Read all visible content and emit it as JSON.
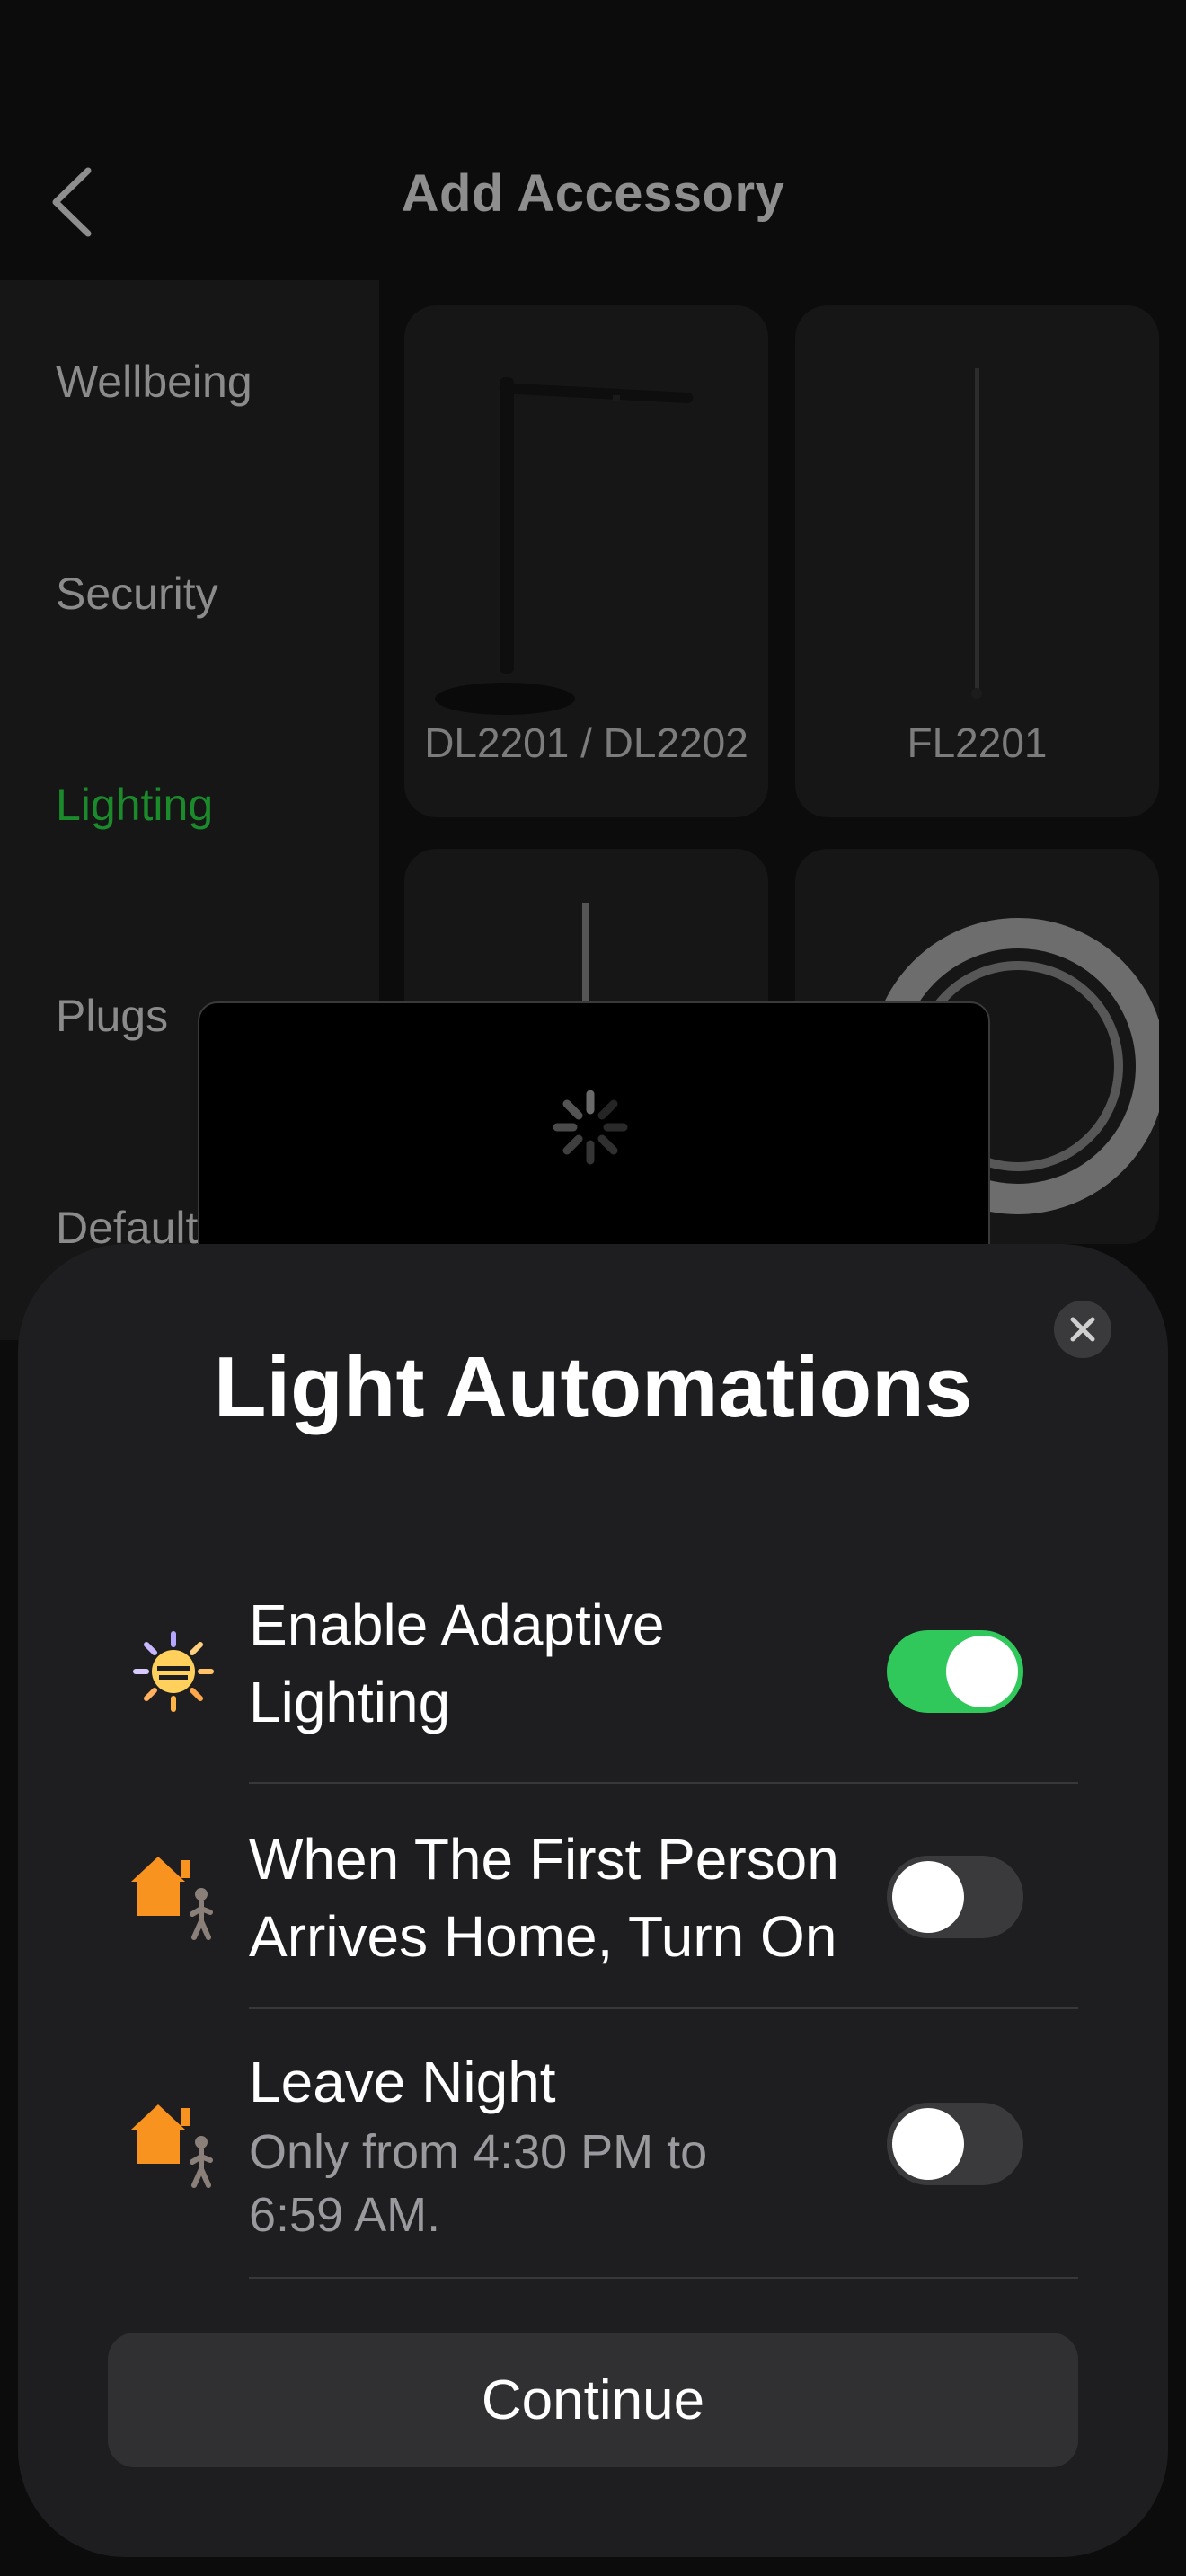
{
  "header": {
    "title": "Add Accessory"
  },
  "sidebar": {
    "items": [
      {
        "label": "Wellbeing",
        "active": false
      },
      {
        "label": "Security",
        "active": false
      },
      {
        "label": "Lighting",
        "active": true
      },
      {
        "label": "Plugs",
        "active": false
      },
      {
        "label": "Default",
        "active": false
      }
    ]
  },
  "products": [
    {
      "label": "DL2201 / DL2202"
    },
    {
      "label": "FL2201"
    }
  ],
  "sheet": {
    "title": "Light Automations",
    "rows": [
      {
        "label_line1": "Enable Adaptive",
        "label_line2": "Lighting",
        "icon": "adaptive-light-icon",
        "enabled": true
      },
      {
        "label_line1": "When The First Person",
        "label_line2": "Arrives Home, Turn On",
        "icon": "home-arrive-icon",
        "enabled": false
      },
      {
        "label": "Leave Night",
        "sub_line1": "Only from 4:30 PM to",
        "sub_line2": "6:59 AM.",
        "icon": "home-leave-icon",
        "enabled": false
      }
    ],
    "continue_label": "Continue"
  },
  "colors": {
    "toggle_on": "#30c85a",
    "active_category": "#1b8a2b",
    "home_icon": "#f7931e"
  }
}
